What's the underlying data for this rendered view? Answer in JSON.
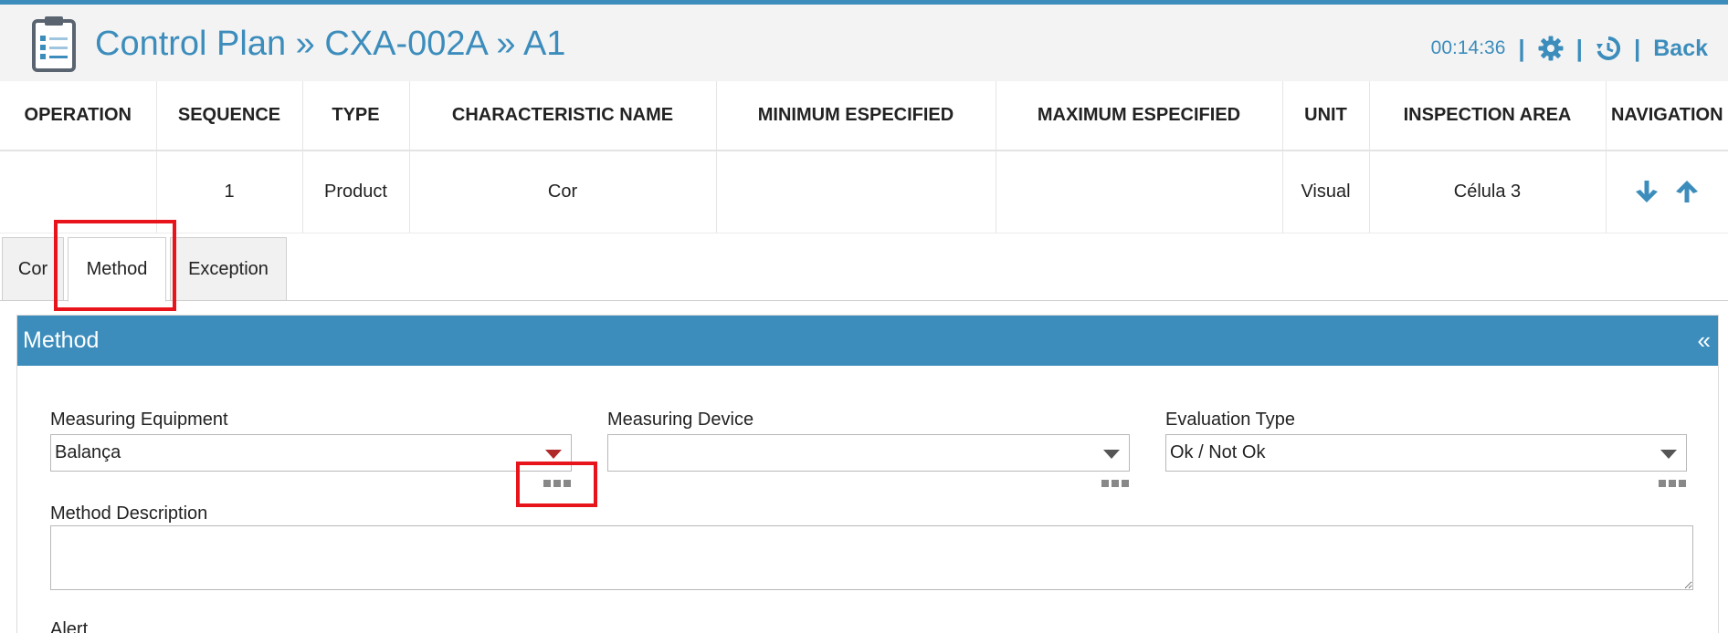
{
  "header": {
    "title": "Control Plan » CXA-002A » A1",
    "timer": "00:14:36",
    "sep": "|",
    "back_label": "Back"
  },
  "table": {
    "columns": [
      "OPERATION",
      "SEQUENCE",
      "TYPE",
      "CHARACTERISTIC NAME",
      "MINIMUM ESPECIFIED",
      "MAXIMUM ESPECIFIED",
      "UNIT",
      "INSPECTION AREA",
      "NAVIGATION"
    ],
    "row": {
      "operation": "",
      "sequence": "1",
      "type": "Product",
      "characteristic_name": "Cor",
      "minimum": "",
      "maximum": "",
      "unit": "Visual",
      "inspection_area": "Célula 3"
    }
  },
  "tabs": [
    {
      "label": "Cor"
    },
    {
      "label": "Method"
    },
    {
      "label": "Exception"
    }
  ],
  "panel": {
    "title": "Method",
    "collapse": "«",
    "measuring_equipment": {
      "label": "Measuring Equipment",
      "value": "Balança"
    },
    "measuring_device": {
      "label": "Measuring Device",
      "value": ""
    },
    "evaluation_type": {
      "label": "Evaluation Type",
      "value": "Ok / Not Ok"
    },
    "method_description": {
      "label": "Method Description",
      "value": ""
    },
    "alert": {
      "label": "Alert"
    }
  },
  "colors": {
    "accent": "#3c8dbc",
    "highlight": "#e8141b"
  }
}
